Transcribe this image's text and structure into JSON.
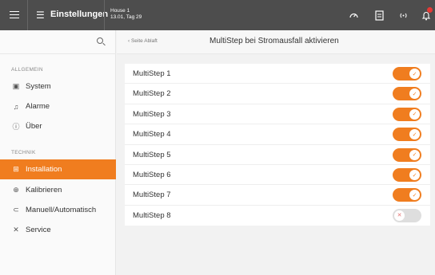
{
  "topbar": {
    "title": "Einstellungen",
    "house_name": "House 1",
    "house_date": "13.01, Tag 29",
    "menu_icon": "hamburger-menu-icon",
    "settings_icon": "sliders-icon",
    "icons": [
      "gauge-icon",
      "document-icon",
      "signal-icon",
      "bell-icon"
    ],
    "badge_color": "#e53935"
  },
  "sidebar": {
    "search_placeholder": "",
    "sections": [
      {
        "label": "ALLGEMEIN",
        "items": [
          {
            "label": "System",
            "icon": "monitor-icon",
            "active": false
          },
          {
            "label": "Alarme",
            "icon": "bell-outline-icon",
            "active": false
          },
          {
            "label": "Über",
            "icon": "info-icon",
            "active": false
          }
        ]
      },
      {
        "label": "TECHNIK",
        "items": [
          {
            "label": "Installation",
            "icon": "install-icon",
            "active": true
          },
          {
            "label": "Kalibrieren",
            "icon": "crosshair-icon",
            "active": false
          },
          {
            "label": "Manuell/Automatisch",
            "icon": "toggle-icon",
            "active": false
          },
          {
            "label": "Service",
            "icon": "tools-icon",
            "active": false
          }
        ]
      }
    ],
    "accent_color": "#f07d1f"
  },
  "content": {
    "breadcrumb": "‹ Seite Ablaft",
    "title": "MultiStep bei Stromausfall aktivieren",
    "rows": [
      {
        "label": "MultiStep 1",
        "enabled": true
      },
      {
        "label": "MultiStep 2",
        "enabled": true
      },
      {
        "label": "MultiStep 3",
        "enabled": true
      },
      {
        "label": "MultiStep 4",
        "enabled": true
      },
      {
        "label": "MultiStep 5",
        "enabled": true
      },
      {
        "label": "MultiStep 6",
        "enabled": true
      },
      {
        "label": "MultiStep 7",
        "enabled": true
      },
      {
        "label": "MultiStep 8",
        "enabled": false
      }
    ]
  }
}
